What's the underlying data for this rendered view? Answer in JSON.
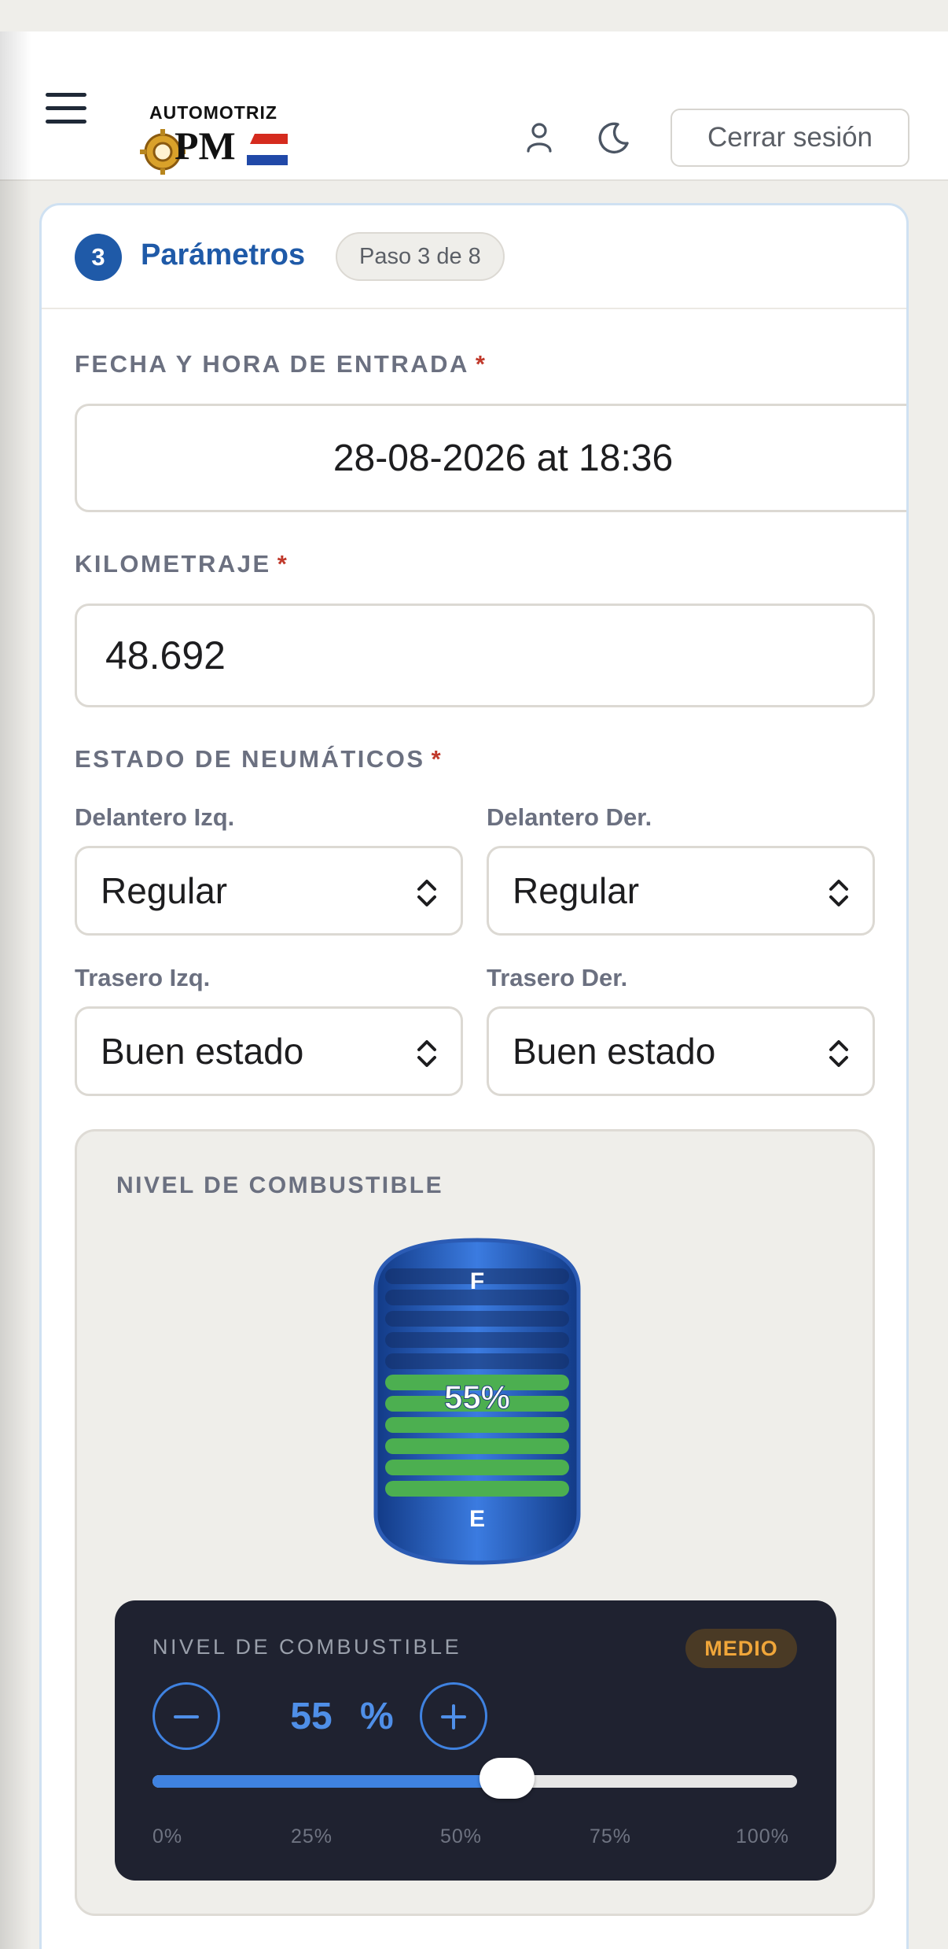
{
  "header": {
    "logo_top": "AUTOMOTRIZ",
    "logo_main": "PM",
    "logout_label": "Cerrar sesión",
    "icons": [
      "menu-icon",
      "user-icon",
      "moon-icon"
    ]
  },
  "step": {
    "number": "3",
    "title": "Parámetros",
    "badge": "Paso 3 de 8"
  },
  "form": {
    "datetime_label": "FECHA Y HORA DE ENTRADA",
    "datetime_value": "28-08-2026 at 18:36",
    "km_label": "KILOMETRAJE",
    "km_value": "48.692",
    "required_mark": "*",
    "tires_label": "ESTADO DE NEUMÁTICOS",
    "tires": [
      {
        "label": "Delantero Izq.",
        "value": "Regular"
      },
      {
        "label": "Delantero Der.",
        "value": "Regular"
      },
      {
        "label": "Trasero Izq.",
        "value": "Buen estado"
      },
      {
        "label": "Trasero Der.",
        "value": "Buen estado"
      }
    ]
  },
  "fuel": {
    "title": "NIVEL DE COMBUSTIBLE",
    "gauge_full": "F",
    "gauge_empty": "E",
    "gauge_percent": "55%",
    "level": 55,
    "panel_label": "NIVEL DE COMBUSTIBLE",
    "status_badge": "MEDIO",
    "value": "55",
    "unit": "%",
    "ticks": [
      "0%",
      "25%",
      "50%",
      "75%",
      "100%"
    ],
    "colors": {
      "accent": "#3f82e0",
      "fill": "#4caf50",
      "badge": "#f0a63a"
    }
  }
}
